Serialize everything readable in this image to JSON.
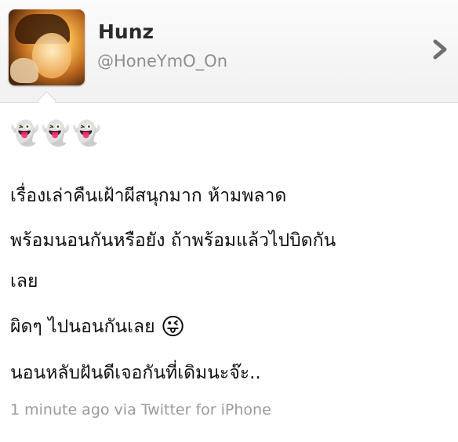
{
  "profile": {
    "display_name": "Hunz",
    "username": "@HoneYmO_On"
  },
  "icons": {
    "avatar": "avatar",
    "disclosure": "chevron-right-icon",
    "ghost": "ghost-emoji",
    "wink": "winking-tongue-emoji"
  },
  "tweet": {
    "emoji_line": "👻👻👻",
    "lines": [
      "เรื่องเล่าคืนเฝ้าผีสนุกมาก ห้ามพลาด",
      "พร้อมนอนกันหรือยัง ถ้าพร้อมแล้วไปบิดกัน",
      "เลย",
      "ผิดๆ ไปนอนกันเลย",
      "นอนหลับฝันดีเจอกันที่เดิมนะจ๊ะ.."
    ],
    "wink_emoji": "😜",
    "meta": "1 minute ago via Twitter for iPhone"
  },
  "colors": {
    "name": "#2b2b2b",
    "handle": "#8e8e8e",
    "meta": "#9a9a9a",
    "chevron": "#6f6f6f"
  }
}
